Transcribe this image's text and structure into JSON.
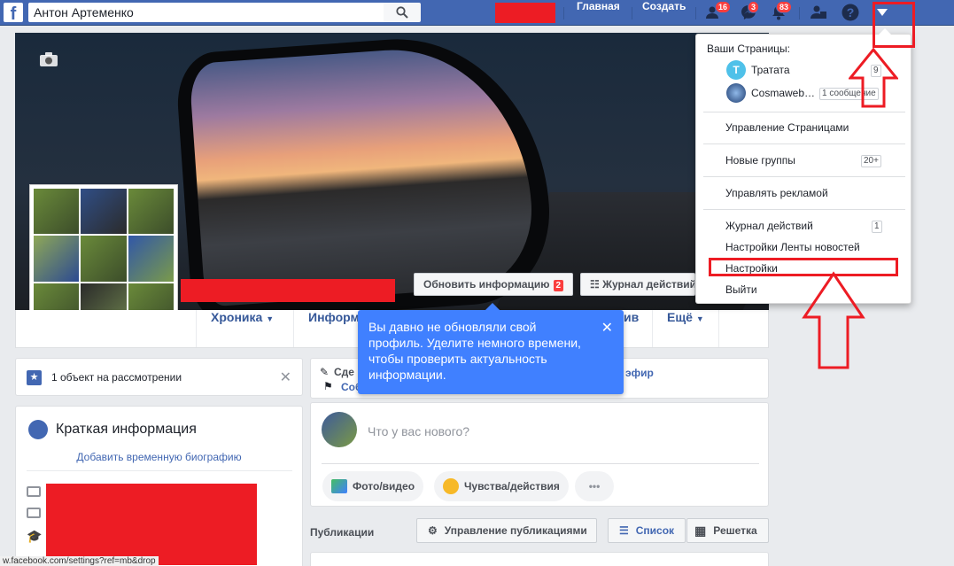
{
  "topbar": {
    "logo": "f",
    "search_value": "Антон Артеменко",
    "nav_home": "Главная",
    "nav_create": "Создать",
    "badge_friends": "16",
    "badge_messages": "3",
    "badge_notifications": "83"
  },
  "cover": {
    "update_info_label": "Обновить информацию",
    "update_info_badge": "2",
    "activity_log_label": "Журнал действий"
  },
  "tabs": {
    "timeline": "Хроника",
    "info": "Информ",
    "archive": "ив",
    "more": "Ещё"
  },
  "tooltip": {
    "text": "Вы давно не обновляли свой профиль. Уделите немного времени, чтобы проверить актуальность информации."
  },
  "review_card": {
    "text": "1 объект на рассмотрении"
  },
  "intro_card": {
    "title": "Краткая информация",
    "link": "Добавить временную биографию"
  },
  "composer": {
    "action_edit": "Сде",
    "action_event": "Соб",
    "action_live": "эфир",
    "placeholder": "Что у вас нового?",
    "photo_video": "Фото/видео",
    "feelings": "Чувства/действия",
    "more": "•••"
  },
  "posts_bar": {
    "title": "Публикации",
    "manage": "Управление публикациями",
    "list": "Список",
    "grid": "Решетка"
  },
  "dropdown": {
    "your_pages": "Ваши Страницы:",
    "pages": [
      {
        "name": "Тратата",
        "avatar_letter": "T",
        "count": "9"
      },
      {
        "name": "Cosmaweb…",
        "count": "1 сообщение"
      }
    ],
    "manage_pages": "Управление Страницами",
    "new_groups": "Новые группы",
    "new_groups_count": "20+",
    "manage_ads": "Управлять рекламой",
    "activity_log": "Журнал действий",
    "activity_log_count": "1",
    "news_feed_settings": "Настройки Ленты новостей",
    "settings": "Настройки",
    "logout": "Выйти"
  },
  "status_url": "w.facebook.com/settings?ref=mb&drop",
  "colors": {
    "brand_blue": "#4267b2",
    "annotation_red": "#ed1c24",
    "tooltip_blue": "#4080ff",
    "badge_red": "#fa3e3e"
  }
}
